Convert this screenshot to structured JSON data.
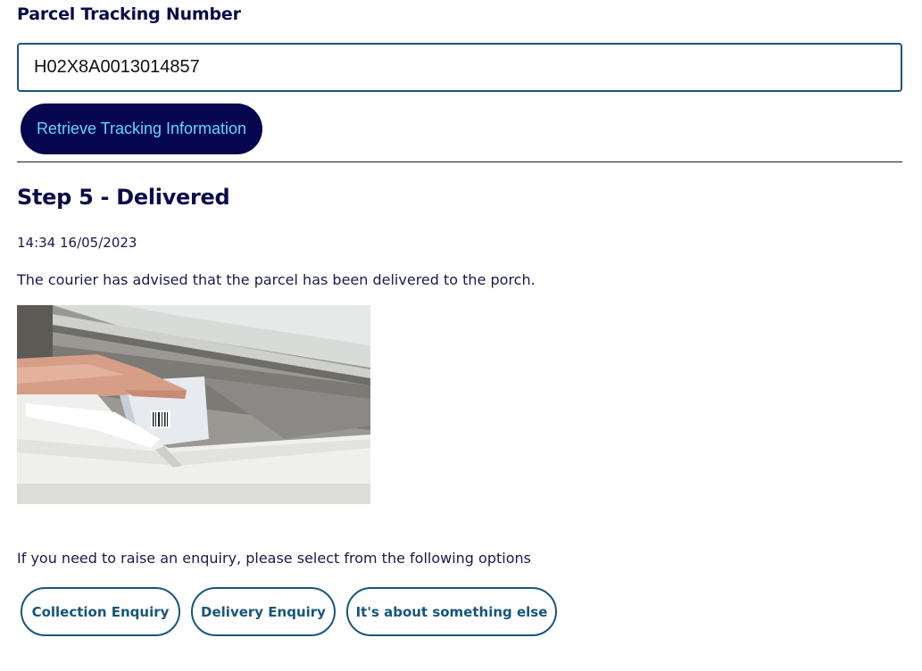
{
  "tracking_form": {
    "label": "Parcel Tracking Number",
    "value": "H02X8A0013014857",
    "button_label": "Retrieve Tracking Information"
  },
  "status": {
    "title": "Step 5 - Delivered",
    "timestamp": "14:34 16/05/2023",
    "message": "The courier has advised that the parcel has been delivered to the porch."
  },
  "enquiry": {
    "prompt": "If you need to raise an enquiry, please select from the following options",
    "options": [
      "Collection Enquiry",
      "Delivery Enquiry",
      "It's about something else"
    ]
  },
  "colors": {
    "heading": "#0b0b4a",
    "primary_button_bg": "#07074f",
    "primary_button_text": "#5fd6ff",
    "outline": "#17567a"
  }
}
